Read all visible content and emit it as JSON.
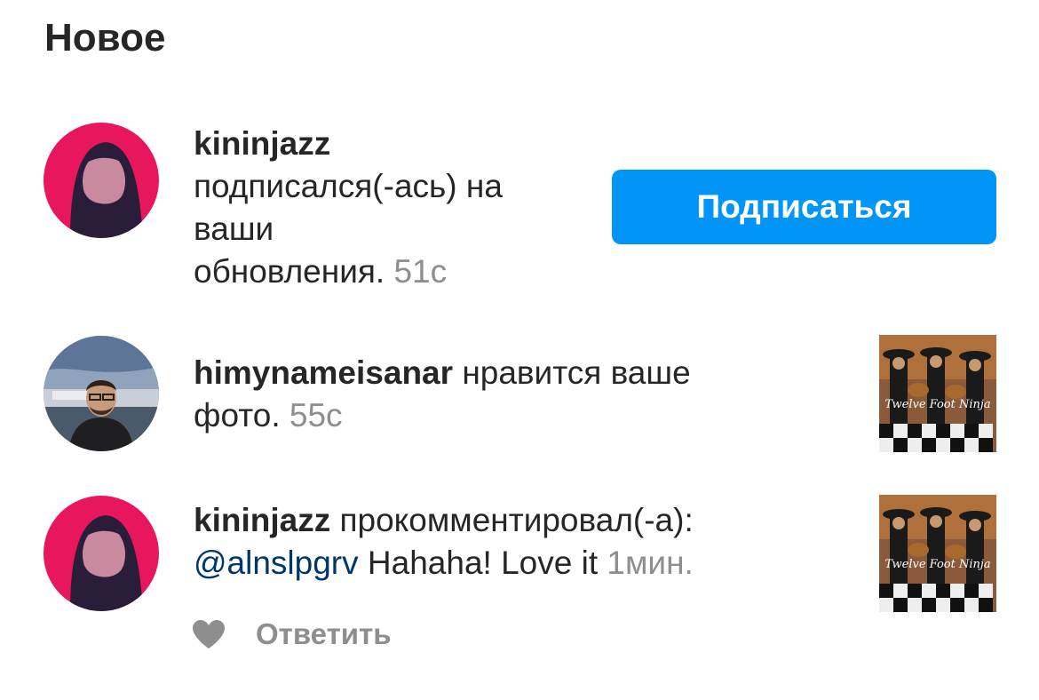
{
  "section": {
    "title": "Новое"
  },
  "notifications": [
    {
      "username": "kininjazz",
      "text_line1": "подписался(-ась) на",
      "text_line2": "ваши",
      "text_line3": "обновления.",
      "time": "51с",
      "action_label": "Подписаться",
      "avatar_icon": "person-avatar-pink"
    },
    {
      "username": "himynameisanar",
      "text_line1": "нравится ваше",
      "text_line2": "фото.",
      "time": "55с",
      "avatar_icon": "person-avatar-outdoor",
      "thumb_text": "Twelve Foot Ninja"
    },
    {
      "username": "kininjazz",
      "text_line1": "прокомментировал(-а):",
      "mention": "@alnslpgrv",
      "comment": "Hahaha! Love it",
      "time": "1мин.",
      "avatar_icon": "person-avatar-pink",
      "thumb_text": "Twelve Foot Ninja",
      "like_icon": "heart-icon",
      "reply_label": "Ответить"
    }
  ],
  "colors": {
    "accent": "#0095f6",
    "muted": "#8e8e8e",
    "mention": "#00376b",
    "avatar_pink": "#e8175d"
  }
}
